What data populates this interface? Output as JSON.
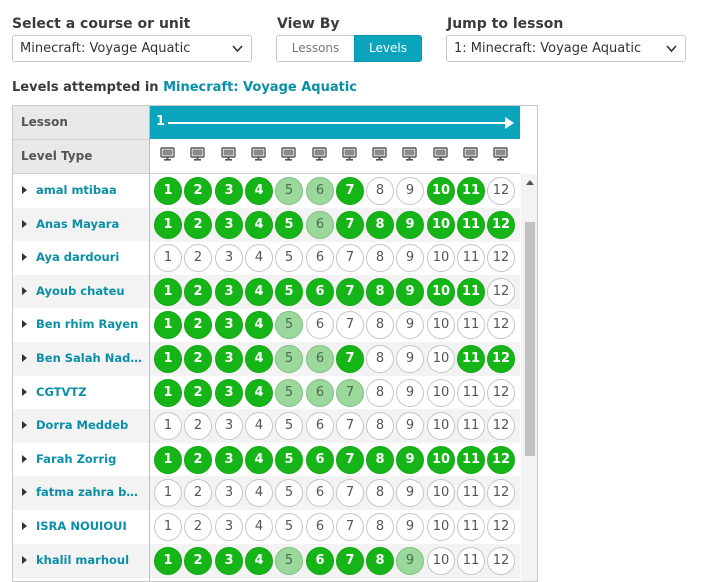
{
  "controls": {
    "course_label": "Select a course or unit",
    "course_value": "Minecraft: Voyage Aquatic",
    "viewby_label": "View By",
    "viewby_lessons": "Lessons",
    "viewby_levels": "Levels",
    "viewby_selected": "Levels",
    "jump_label": "Jump to lesson",
    "jump_value": "1: Minecraft: Voyage Aquatic"
  },
  "heading": {
    "prefix": "Levels attempted in ",
    "course": "Minecraft: Voyage Aquatic"
  },
  "table": {
    "lesson_header": "Lesson",
    "lesson_number": "1",
    "level_type_header": "Level Type",
    "level_type_icon": "computer-icon",
    "levels": [
      "1",
      "2",
      "3",
      "4",
      "5",
      "6",
      "7",
      "8",
      "9",
      "10",
      "11",
      "12"
    ],
    "rows": [
      {
        "name": "amal mtibaa",
        "status": [
          "done",
          "done",
          "done",
          "done",
          "part",
          "part",
          "done",
          "none",
          "none",
          "done",
          "done",
          "none"
        ]
      },
      {
        "name": "Anas Mayara",
        "status": [
          "done",
          "done",
          "done",
          "done",
          "done",
          "part",
          "done",
          "done",
          "done",
          "done",
          "done",
          "done"
        ]
      },
      {
        "name": "Aya dardouri",
        "status": [
          "none",
          "none",
          "none",
          "none",
          "none",
          "none",
          "none",
          "none",
          "none",
          "none",
          "none",
          "none"
        ]
      },
      {
        "name": "Ayoub chateu",
        "status": [
          "done",
          "done",
          "done",
          "done",
          "done",
          "done",
          "done",
          "done",
          "done",
          "done",
          "done",
          "none"
        ]
      },
      {
        "name": "Ben rhim Rayen",
        "status": [
          "done",
          "done",
          "done",
          "done",
          "part",
          "none",
          "none",
          "none",
          "none",
          "none",
          "none",
          "none"
        ]
      },
      {
        "name": "Ben Salah Nadine",
        "status": [
          "done",
          "done",
          "done",
          "done",
          "part",
          "part",
          "done",
          "none",
          "none",
          "none",
          "done",
          "done"
        ]
      },
      {
        "name": "CGTVTZ",
        "status": [
          "done",
          "done",
          "done",
          "done",
          "part",
          "part",
          "part",
          "none",
          "none",
          "none",
          "none",
          "none"
        ]
      },
      {
        "name": "Dorra Meddeb",
        "status": [
          "none",
          "none",
          "none",
          "none",
          "none",
          "none",
          "none",
          "none",
          "none",
          "none",
          "none",
          "none"
        ]
      },
      {
        "name": "Farah Zorrig",
        "status": [
          "done",
          "done",
          "done",
          "done",
          "done",
          "done",
          "done",
          "done",
          "done",
          "done",
          "done",
          "done"
        ]
      },
      {
        "name": "fatma zahra bot...",
        "status": [
          "none",
          "none",
          "none",
          "none",
          "none",
          "none",
          "none",
          "none",
          "none",
          "none",
          "none",
          "none"
        ]
      },
      {
        "name": "ISRA NOUIOUI",
        "status": [
          "none",
          "none",
          "none",
          "none",
          "none",
          "none",
          "none",
          "none",
          "none",
          "none",
          "none",
          "none"
        ]
      },
      {
        "name": "khalil marhoul",
        "status": [
          "done",
          "done",
          "done",
          "done",
          "part",
          "done",
          "done",
          "done",
          "part",
          "none",
          "none",
          "none"
        ]
      }
    ]
  },
  "colors": {
    "accent": "#0aa5bd",
    "link": "#0a8fa6",
    "done": "#15b517",
    "partial": "#9ad99b"
  }
}
